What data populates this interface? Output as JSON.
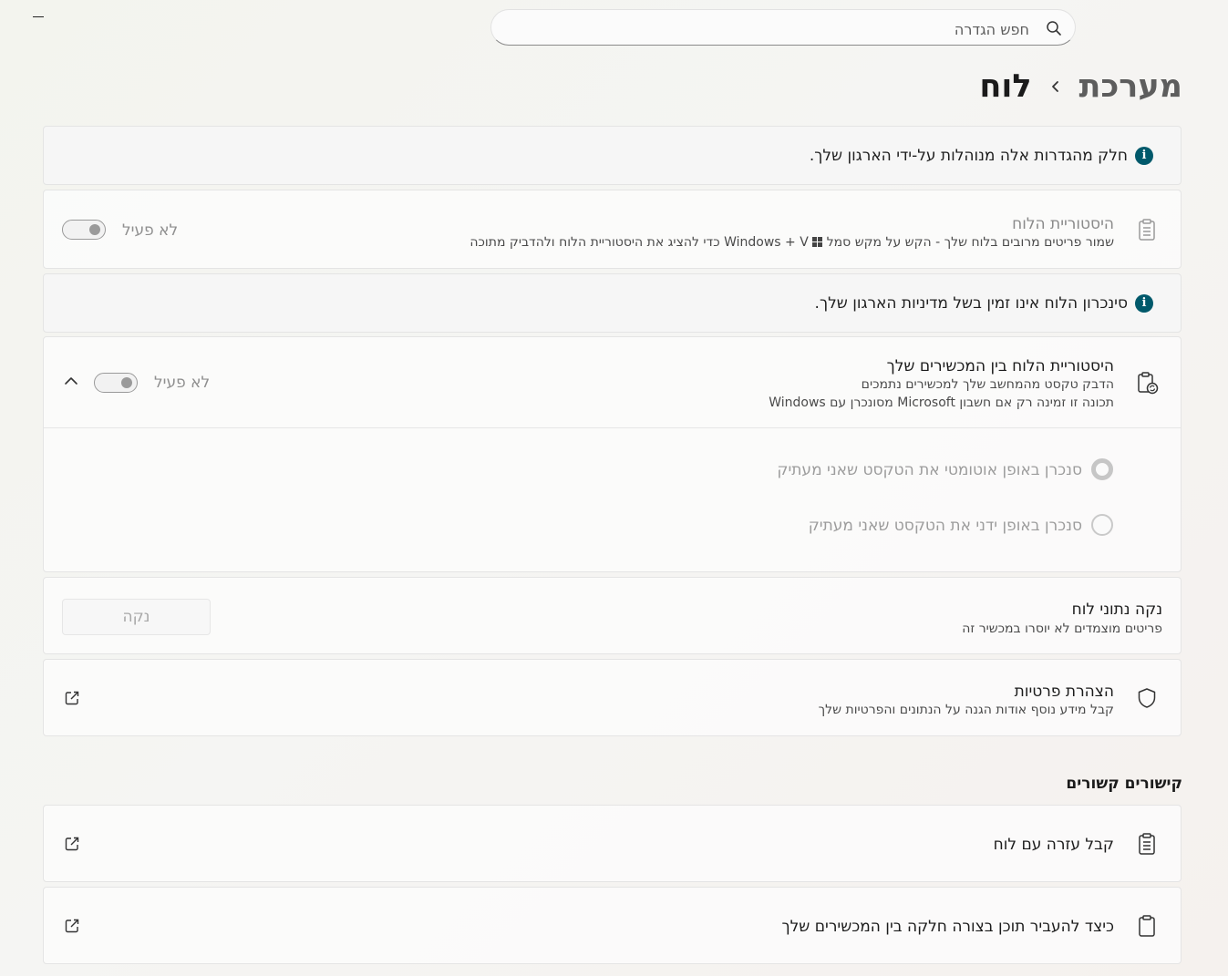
{
  "window": {
    "minimize_icon": "minimize-icon"
  },
  "search": {
    "placeholder": "חפש הגדרה",
    "value": ""
  },
  "breadcrumb": {
    "parent": "מערכת",
    "current": "לוח"
  },
  "notices": {
    "managed": "חלק מהגדרות אלה מנוהלות על-ידי הארגון שלך.",
    "sync_unavailable": "סינכרון הלוח אינו זמין בשל מדיניות הארגון שלך."
  },
  "clipboard_history": {
    "title": "היסטוריית הלוח",
    "desc_part1": "שמור פריטים מרובים בלוח שלך - הקש על מקש סמל",
    "desc_key_windows": "Windows",
    "desc_plus": "+",
    "desc_key_v": "V",
    "desc_part2": "כדי להציג את היסטוריית הלוח ולהדביק מתוכה",
    "toggle_label": "לא פעיל",
    "toggle_on": false
  },
  "cross_device": {
    "title": "היסטוריית הלוח בין המכשירים שלך",
    "desc_line1": "הדבק טקסט מהמחשב שלך למכשירים נתמכים",
    "desc_line2": "תכונה זו זמינה רק אם חשבון Microsoft מסונכרן עם Windows",
    "toggle_label": "לא פעיל",
    "toggle_on": false,
    "expanded": true,
    "options": [
      {
        "label": "סנכרן באופן אוטומטי את הטקסט שאני מעתיק",
        "selected": true
      },
      {
        "label": "סנכרן באופן ידני את הטקסט שאני מעתיק",
        "selected": false
      }
    ]
  },
  "clear_data": {
    "title": "נקה נתוני לוח",
    "desc": "פריטים מוצמדים לא יוסרו במכשיר זה",
    "button_label": "נקה"
  },
  "privacy": {
    "title": "הצהרת פרטיות",
    "desc": "קבל מידע נוסף אודות הגנה על הנתונים והפרטיות שלך"
  },
  "related_links": {
    "section_title": "קישורים קשורים",
    "items": [
      {
        "label": "קבל עזרה עם לוח"
      },
      {
        "label": "כיצד להעביר תוכן בצורה חלקה בין המכשירים שלך"
      }
    ]
  },
  "colors": {
    "info_icon": "#00596b",
    "disabled_text": "#8f8f8f"
  }
}
